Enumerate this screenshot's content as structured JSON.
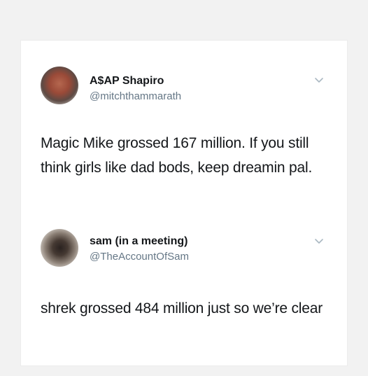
{
  "tweets": [
    {
      "display_name": "A$AP Shapiro",
      "handle": "@mitchthammarath",
      "text": "Magic Mike grossed 167 million. If you still think girls like dad bods, keep dreamin pal."
    },
    {
      "display_name": "sam (in a meeting)",
      "handle": "@TheAccountOfSam",
      "text": "shrek grossed 484 million just so we’re clear"
    }
  ],
  "icons": {
    "chevron": "chevron-down-icon"
  },
  "colors": {
    "background": "#f2f2f2",
    "card": "#ffffff",
    "primary_text": "#14171a",
    "secondary_text": "#657786",
    "chevron": "#aab8c2"
  }
}
